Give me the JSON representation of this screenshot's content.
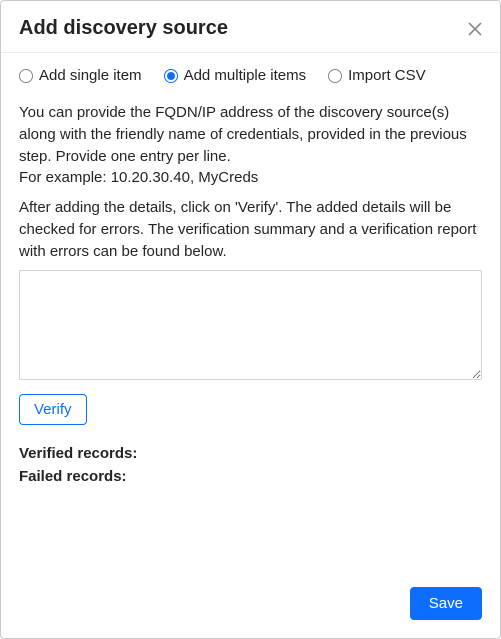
{
  "header": {
    "title": "Add discovery source"
  },
  "mode": {
    "selected": "multiple",
    "options": {
      "single": {
        "label": "Add single item"
      },
      "multiple": {
        "label": "Add multiple items"
      },
      "csv": {
        "label": "Import CSV"
      }
    }
  },
  "instructions": {
    "main": "You can provide the FQDN/IP address of the discovery source(s) along with the friendly name of credentials, provided in the previous step. Provide one entry per line.",
    "example": "For example: 10.20.30.40, MyCreds",
    "after": "After adding the details, click on 'Verify'. The added details will be checked for errors. The verification summary and a verification report with errors can be found below."
  },
  "entries": {
    "value": "",
    "placeholder": ""
  },
  "actions": {
    "verify_label": "Verify",
    "save_label": "Save"
  },
  "summary": {
    "verified_label": "Verified records:",
    "verified_value": "",
    "failed_label": "Failed records:",
    "failed_value": ""
  }
}
